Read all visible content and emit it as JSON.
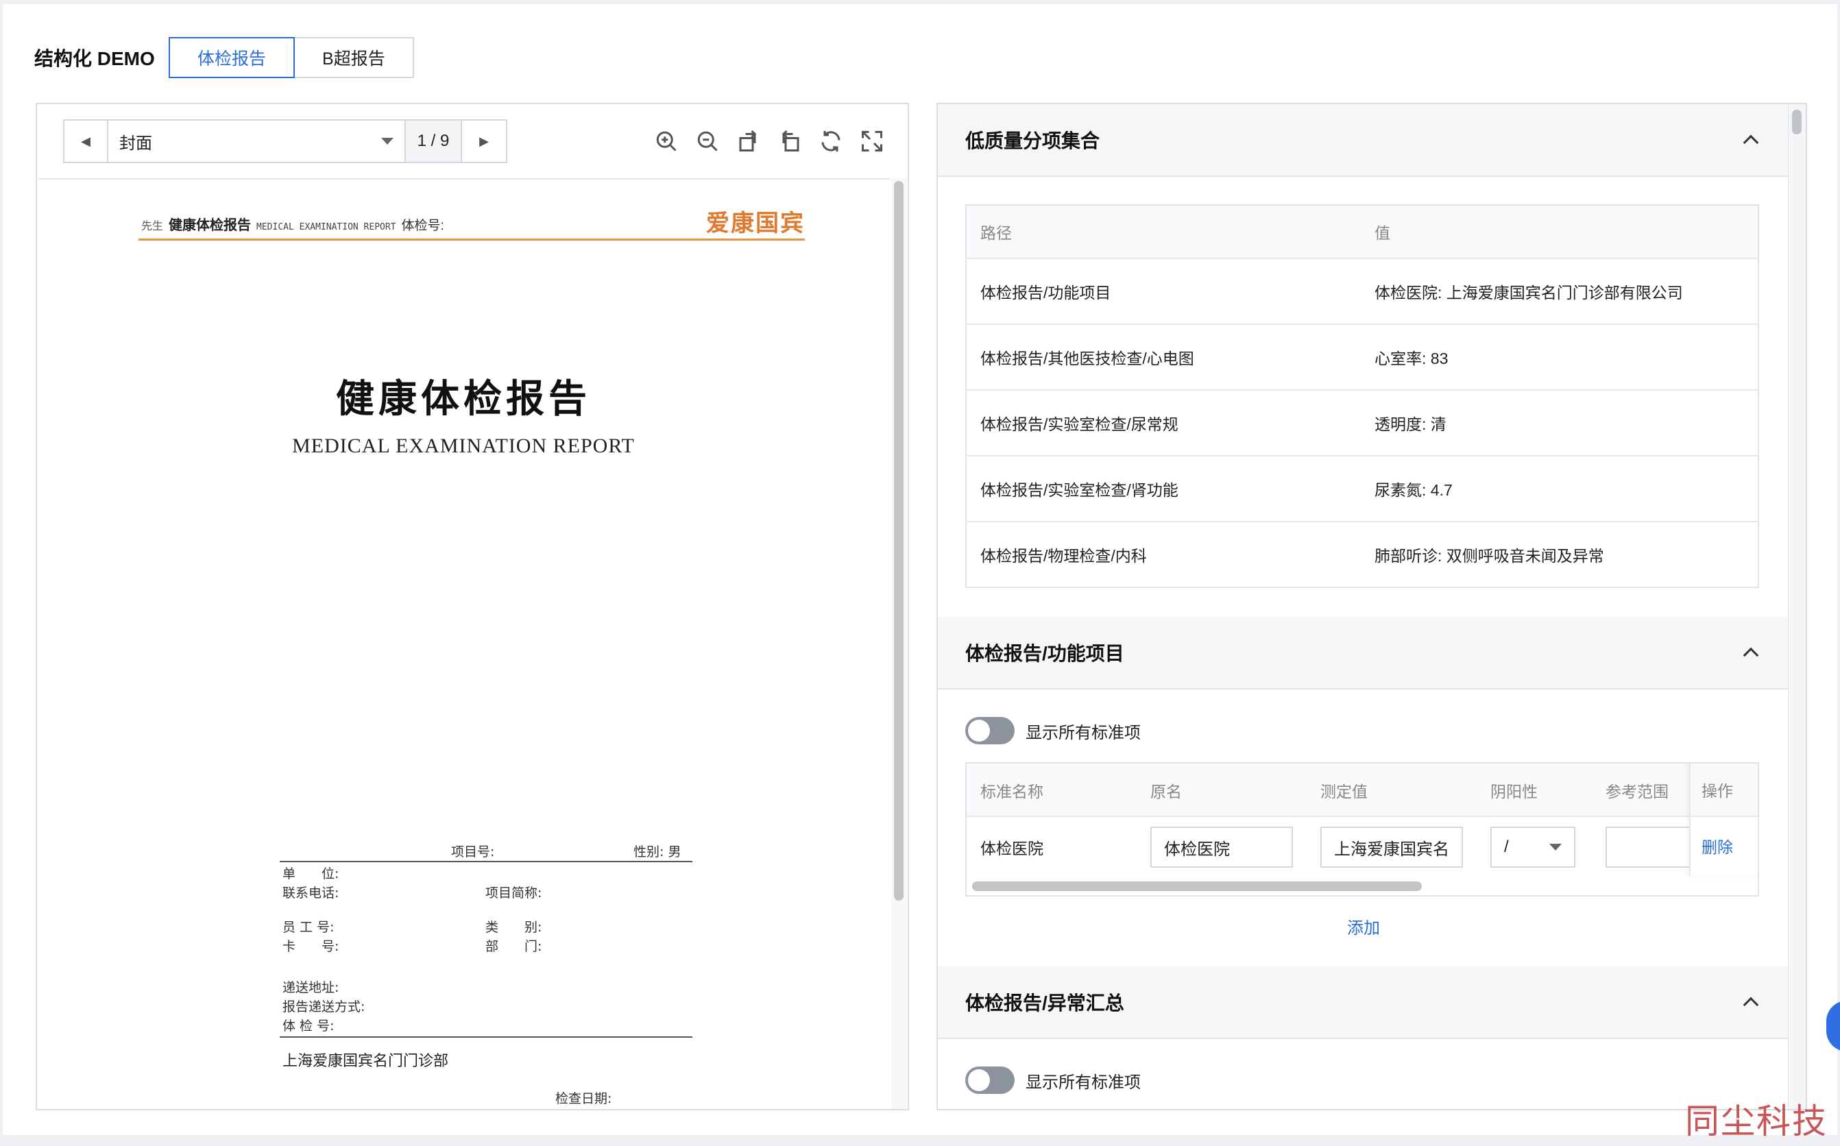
{
  "header": {
    "title": "结构化 DEMO",
    "tabs": [
      {
        "label": "体检报告",
        "active": true
      },
      {
        "label": "B超报告",
        "active": false
      }
    ]
  },
  "viewer": {
    "page_select": "封面",
    "page_count": "1 / 9",
    "tools": [
      "zoom-in-icon",
      "zoom-out-icon",
      "rotate-left-icon",
      "rotate-right-icon",
      "refresh-icon",
      "fullscreen-icon"
    ]
  },
  "document": {
    "head_prefix": "先生",
    "head_title": "健康体检报告",
    "head_en": "MEDICAL EXAMINATION REPORT",
    "head_no": "体检号:",
    "brand": "爱康国宾",
    "title": "健康体检报告",
    "subtitle": "MEDICAL EXAMINATION REPORT",
    "fields": {
      "project_no": "项目号:",
      "gender": "性别: 男",
      "unit": "单　　位:",
      "phone": "联系电话:",
      "project_name": "项目简称:",
      "employee_no": "员 工 号:",
      "category": "类　　别:",
      "card_no": "卡　　号:",
      "department": "部　　门:",
      "address": "递送地址:",
      "delivery": "报告递送方式:",
      "exam_no": "体 检 号:",
      "clinic": "上海爱康国宾名门门诊部",
      "exam_date": "检查日期:"
    }
  },
  "panel": {
    "sections": [
      {
        "title": "低质量分项集合"
      },
      {
        "title": "体检报告/功能项目"
      },
      {
        "title": "体检报告/异常汇总"
      }
    ],
    "kv_table": {
      "headers": [
        "路径",
        "值"
      ],
      "rows": [
        [
          "体检报告/功能项目",
          "体检医院: 上海爱康国宾名门门诊部有限公司"
        ],
        [
          "体检报告/其他医技检查/心电图",
          "心室率: 83"
        ],
        [
          "体检报告/实验室检查/尿常规",
          "透明度: 清"
        ],
        [
          "体检报告/实验室检查/肾功能",
          "尿素氮: 4.7"
        ],
        [
          "体检报告/物理检查/内科",
          "肺部听诊: 双侧呼吸音未闻及异常"
        ]
      ]
    },
    "toggle_label": "显示所有标准项",
    "grid": {
      "headers": [
        "标准名称",
        "原名",
        "测定值",
        "阴阳性",
        "参考范围",
        "操作"
      ],
      "row": {
        "standard_name": "体检医院",
        "original_name": "体检医院",
        "measured": "上海爱康国宾名",
        "polarity": "/",
        "reference": "",
        "action": "删除"
      }
    },
    "add_label": "添加"
  },
  "watermark": "同尘科技"
}
